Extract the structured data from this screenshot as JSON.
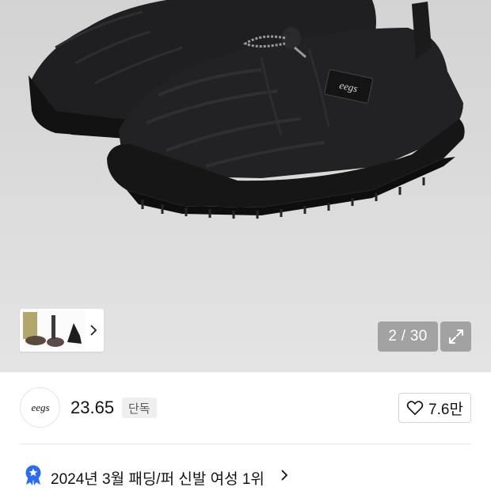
{
  "gallery": {
    "counter": "2 / 30",
    "thumbnail_strip": "product-color-thumbnails"
  },
  "brand": {
    "logo_text": "eegs",
    "name": "23.65",
    "badge": "단독"
  },
  "like": {
    "count": "7.6만",
    "icon": "heart-outline-icon"
  },
  "ranking": {
    "text": "2024년 3월 패딩/퍼 신발 여성 1위",
    "icon": "blue-award-ribbon-icon"
  },
  "colors": {
    "hero_bg": "#d8d8d8",
    "counter_bg": "#8a8a8a",
    "rank_icon": "#2c6df0",
    "badge_bg": "#efefef"
  }
}
